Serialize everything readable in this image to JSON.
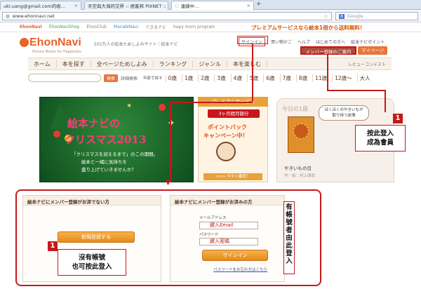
{
  "browser": {
    "tabs": [
      {
        "label": "uki.uang@gmail.com的收..."
      },
      {
        "label": "天空與大海的交界 :: 痞客邦 PIXNET ::"
      },
      {
        "label": "連線中..."
      }
    ],
    "url": "www.ehonnavi.net",
    "search_placeholder": "Google"
  },
  "site": {
    "top_links": [
      "EhonNavi",
      "EhonNaviShop",
      "EhonClub",
      "ManabiNavi",
      "できるナビ",
      "hapy mom program"
    ],
    "promo": "プレミアムサービスなら絵本1冊から送料無料！",
    "logo": "EhonNavi",
    "logo_sub": "Picture Books for Happiness",
    "tagline": "555万人の絵本ためしよみサイト｜絵本ナビ",
    "header_links": {
      "login": "サインイン",
      "cart": "買い物かご",
      "help": "ヘルプ",
      "first": "はじめての方へ",
      "points": "絵本ナビポイント",
      "register": "メンバー登録のご案内",
      "mypage": "マイページ"
    },
    "nav": [
      "ホーム",
      "本を探す",
      "全ページためしよみ",
      "ランキング",
      "ジャンル",
      "本を楽しむ"
    ],
    "review_contest": "レビューコンテスト",
    "search": {
      "button": "検索",
      "detail": "詳細検索",
      "age_label": "年齢で探す"
    },
    "ages": [
      "0歳",
      "1歳",
      "2歳",
      "3歳",
      "4歳",
      "5歳",
      "6歳",
      "7歳",
      "8歳",
      "11歳",
      "12歳〜",
      "大人"
    ]
  },
  "banners": {
    "xmas": {
      "title1": "絵本ナビの",
      "title2": "クリスマス2013",
      "line1": "「クリスマスを迎えるまで」のこの期間。",
      "line2": "絵本と一緒に気持ちを",
      "line3": "盛り上げていきませんか？"
    },
    "premium": {
      "header": "プレミアムサービス",
      "badge": "3ヶ月間月額分",
      "line1": "ポイントバック",
      "line2": "キャンペーン中！",
      "link": ">>> 今すぐ確認！"
    },
    "today": {
      "label": "今日の1冊",
      "bubble1": "ほくほくのやきいもが",
      "bubble2": "取り持つ友情",
      "caption": "やきいもの日",
      "subcaption": "作・絵：村上康成"
    }
  },
  "annotations": {
    "top": {
      "number": "1",
      "text1": "按此登入",
      "text2": "成為會員"
    },
    "bottom": {
      "number": "1",
      "text1": "沒有帳號",
      "text2": "也可按此登入"
    },
    "vertical": "有帳號者由此登入"
  },
  "members": {
    "not_member": {
      "header": "絵本ナビにメンバー登録がお済でない方",
      "button": "新規登録する"
    },
    "member": {
      "header": "絵本ナビにメンバー登録がお済みの方",
      "email_label": "メールアドレス",
      "email_hint": "鍵入Email",
      "password_label": "パスワード",
      "password_hint": "鍵入密碼",
      "signin": "サインイン",
      "forgot": "パスワードをお忘れ方はこちら"
    }
  }
}
